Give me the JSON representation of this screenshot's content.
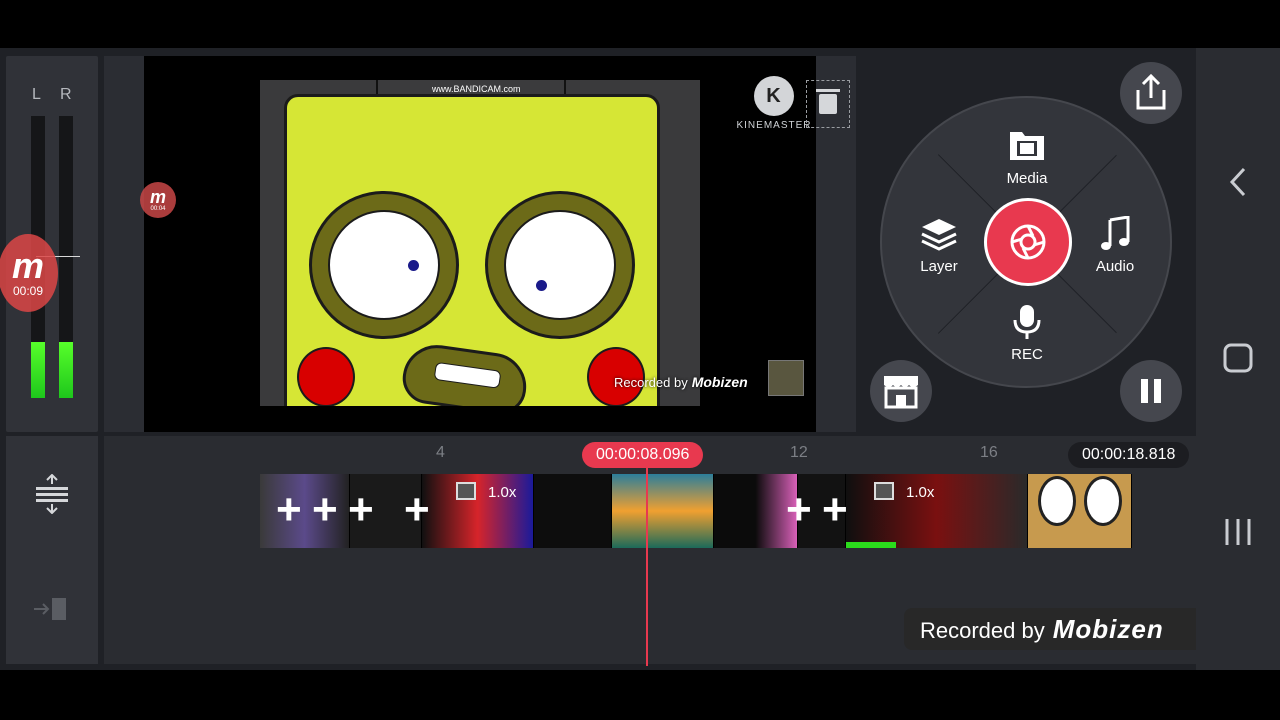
{
  "meter": {
    "left_label": "L",
    "right_label": "R",
    "left_level": 0.2,
    "right_level": 0.2
  },
  "preview": {
    "bandicam_watermark": "www.BANDICAM.com",
    "kinemaster_logo": "KINEMASTER",
    "kinemaster_glyph": "K",
    "recorded_by": "Recorded by",
    "mobizen_brand": "Mobizen"
  },
  "mobizen_floating": {
    "glyph": "m",
    "time": "00:09",
    "small_time": "00:04"
  },
  "wheel": {
    "media_label": "Media",
    "layer_label": "Layer",
    "audio_label": "Audio",
    "rec_label": "REC"
  },
  "timeline": {
    "current_time": "00:00:08.096",
    "total_time": "00:00:18.818",
    "ruler": [
      "4",
      "12",
      "16"
    ],
    "speed_labels": [
      "1.0x",
      "1.0x"
    ],
    "plus": "+"
  },
  "recording_banner": {
    "text": "Recorded by",
    "brand": "Mobizen"
  },
  "colors": {
    "accent": "#e8394f",
    "background": "#1f2126",
    "meter": "#3fe81e"
  }
}
